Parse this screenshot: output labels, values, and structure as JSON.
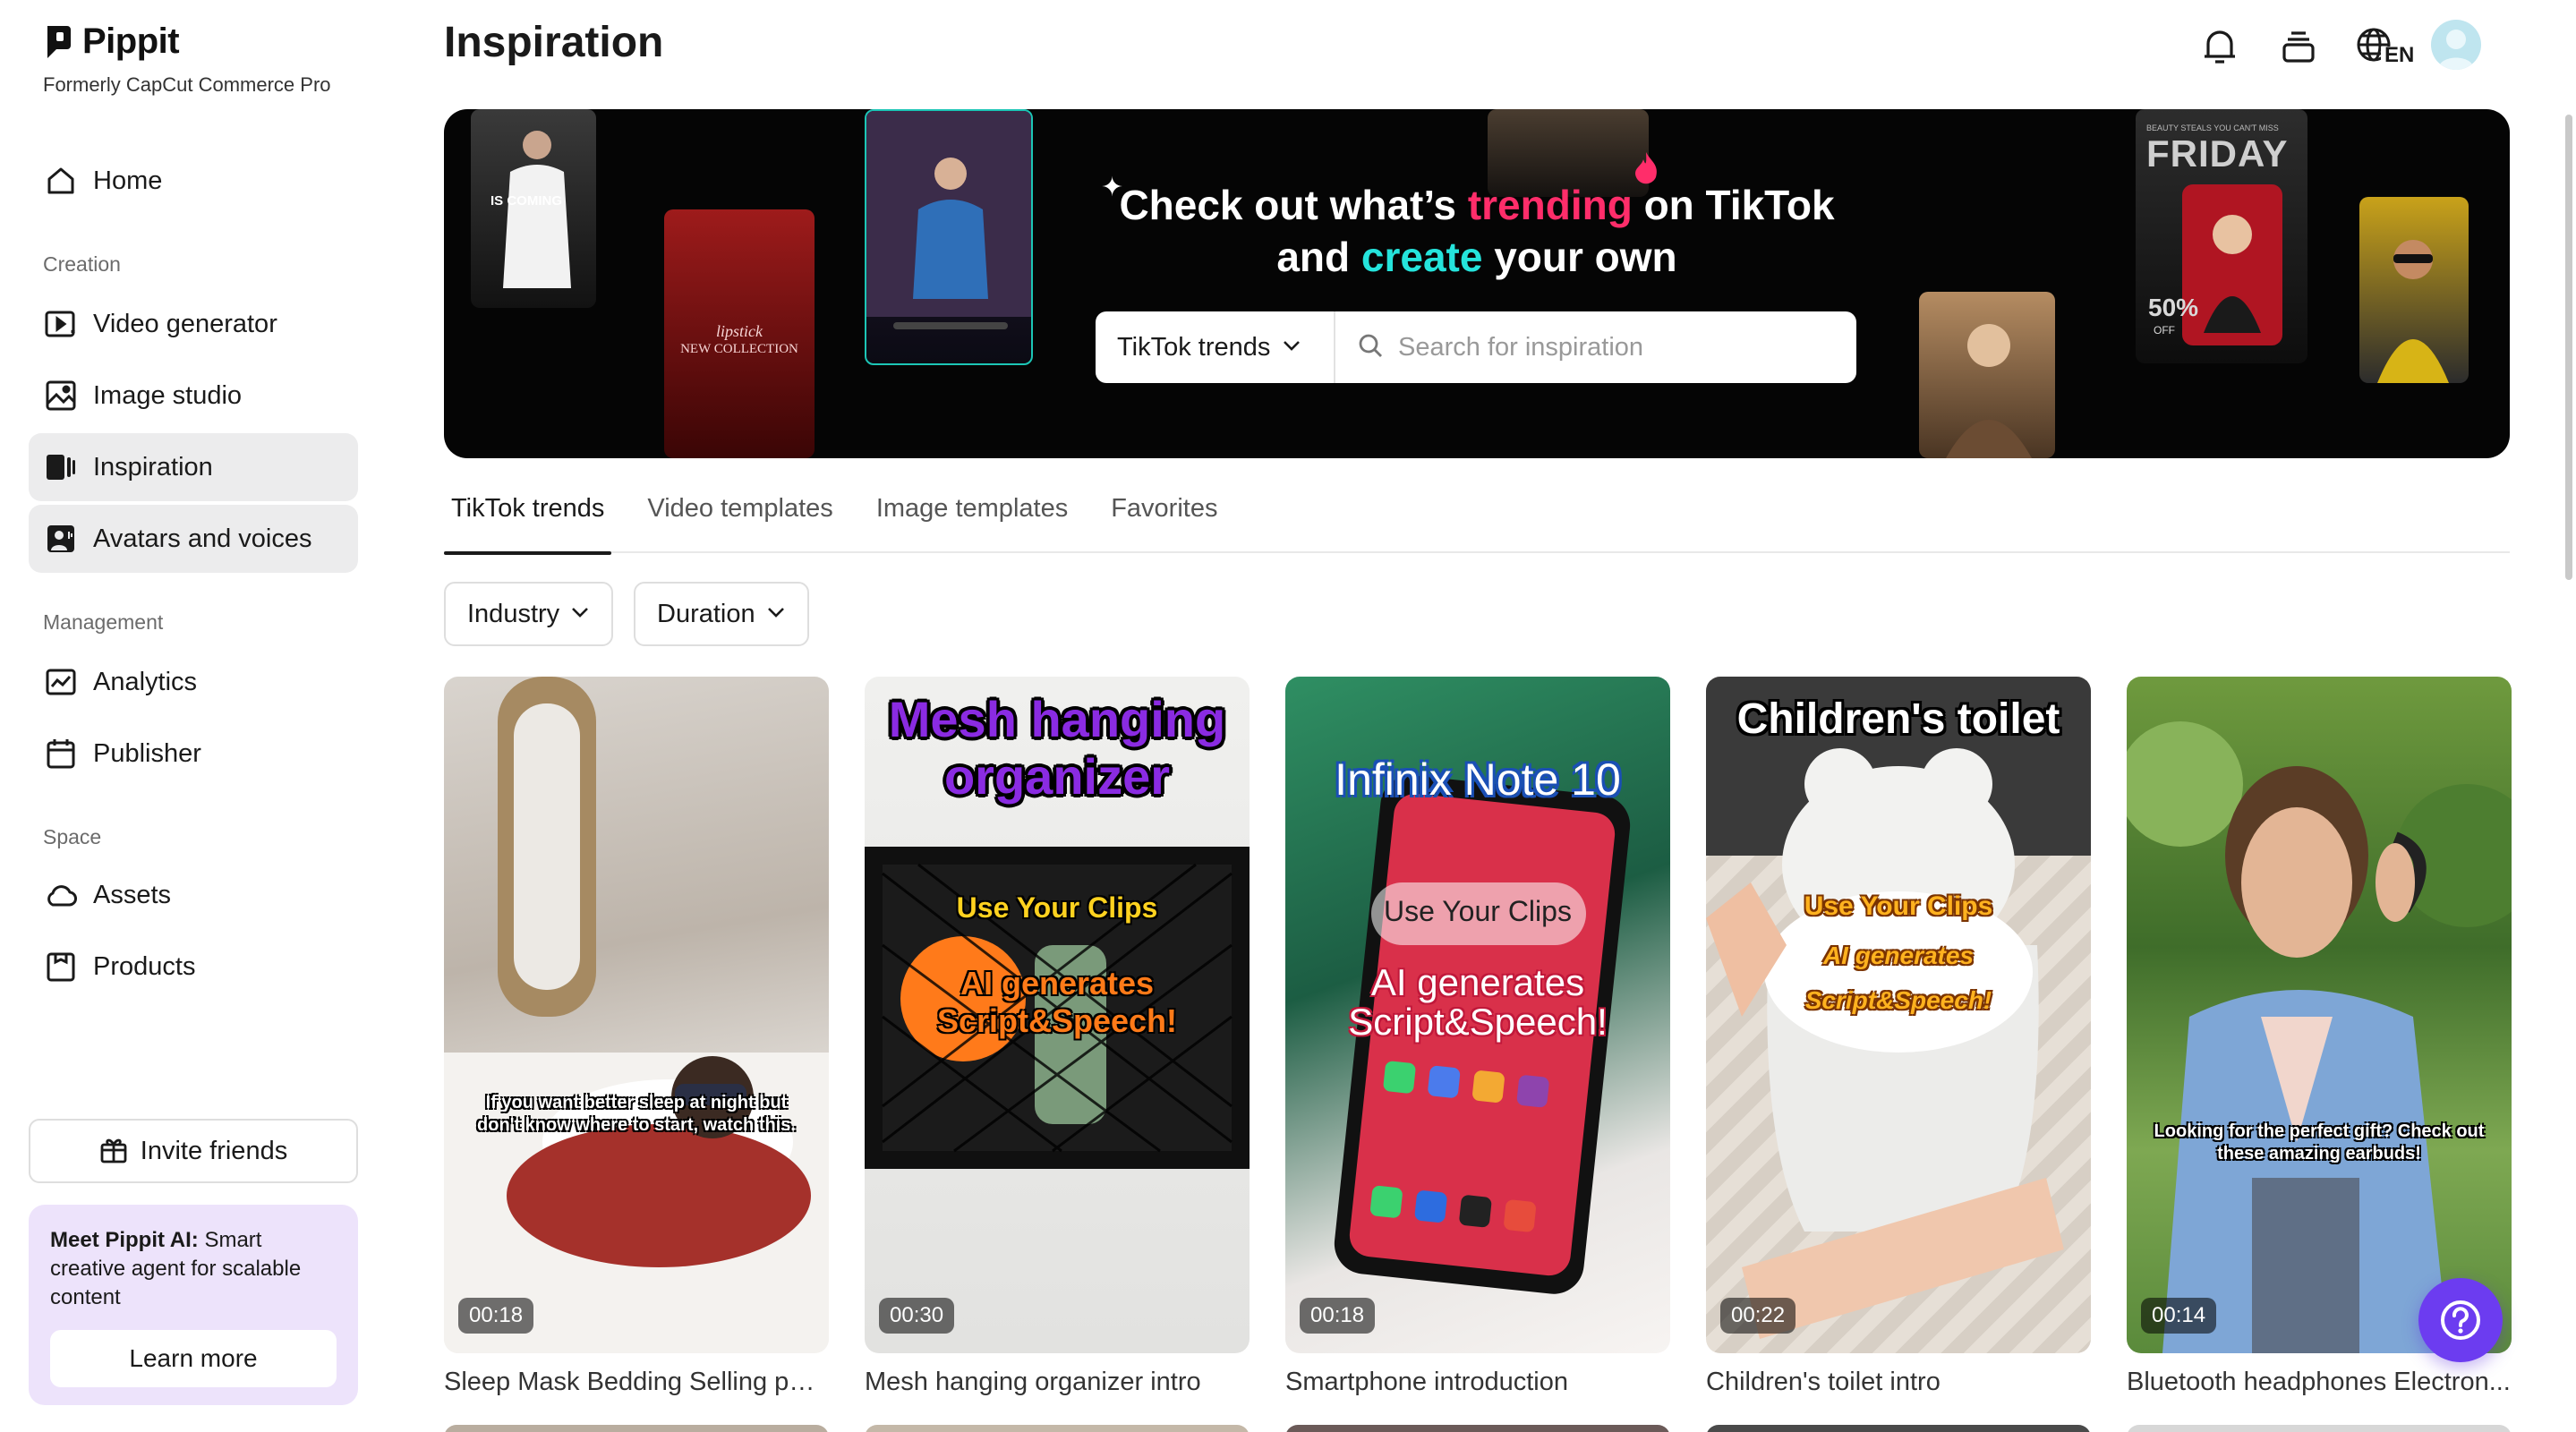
{
  "brand": {
    "name": "Pippit",
    "subtitle": "Formerly CapCut Commerce Pro"
  },
  "sidebar": {
    "primary": [
      {
        "label": "Home",
        "icon": "home-icon"
      }
    ],
    "creation_title": "Creation",
    "creation": [
      {
        "label": "Video generator",
        "icon": "video-generator-icon"
      },
      {
        "label": "Image studio",
        "icon": "image-studio-icon"
      },
      {
        "label": "Inspiration",
        "icon": "inspiration-icon",
        "active": true
      },
      {
        "label": "Avatars and voices",
        "icon": "avatar-icon",
        "active": true
      }
    ],
    "management_title": "Management",
    "management": [
      {
        "label": "Analytics",
        "icon": "analytics-icon"
      },
      {
        "label": "Publisher",
        "icon": "calendar-icon"
      }
    ],
    "space_title": "Space",
    "space": [
      {
        "label": "Assets",
        "icon": "cloud-icon"
      },
      {
        "label": "Products",
        "icon": "products-icon"
      }
    ],
    "invite_label": "Invite friends",
    "promo": {
      "bold": "Meet Pippit AI:",
      "text": " Smart creative agent for scalable content",
      "button": "Learn more"
    }
  },
  "header": {
    "title": "Inspiration",
    "language": "EN"
  },
  "banner": {
    "line1_a": "Check out what’s ",
    "line1_highlight": "trending",
    "line1_b": " on TikTok",
    "line2_a": "and ",
    "line2_highlight": "create",
    "line2_b": " your own",
    "select_label": "TikTok trends",
    "search_placeholder": "Search for inspiration",
    "colors": {
      "pink": "#ff2d6a",
      "cyan": "#25e4dc"
    },
    "thumb_texts": {
      "coming": "IS COMING",
      "lipstick": "lipstick",
      "collection": "NEW COLLECTION",
      "friday": "FRIDAY",
      "sale": "50%",
      "off": "OFF",
      "promo_small": "BEAUTY STEALS YOU CAN'T MISS"
    }
  },
  "tabs": [
    {
      "label": "TikTok trends",
      "active": true
    },
    {
      "label": "Video templates"
    },
    {
      "label": "Image templates"
    },
    {
      "label": "Favorites"
    }
  ],
  "filters": [
    {
      "label": "Industry"
    },
    {
      "label": "Duration"
    }
  ],
  "cards": [
    {
      "title": "Sleep Mask Bedding Selling poi...",
      "duration": "00:18",
      "caption": "If you want better sleep at night but don't know where to start, watch this."
    },
    {
      "title": "Mesh hanging organizer intro",
      "duration": "00:30",
      "headline": "Mesh hanging organizer",
      "clips": "Use Your Clips",
      "ai1": "AI generates",
      "ai2": "Script&Speech!"
    },
    {
      "title": "Smartphone introduction",
      "duration": "00:18",
      "headline": "Infinix Note 10",
      "clips": "Use Your Clips",
      "ai1": "AI generates",
      "ai2": "Script&Speech!"
    },
    {
      "title": "Children's toilet intro",
      "duration": "00:22",
      "headline": "Children's toilet",
      "clips": "Use Your Clips",
      "ai1": "AI generates",
      "ai2": "Script&Speech!"
    },
    {
      "title": "Bluetooth headphones Electron...",
      "duration": "00:14",
      "caption": "Looking for the perfect gift? Check out these amazing earbuds!"
    }
  ],
  "accent_color": "#6c3cf0"
}
